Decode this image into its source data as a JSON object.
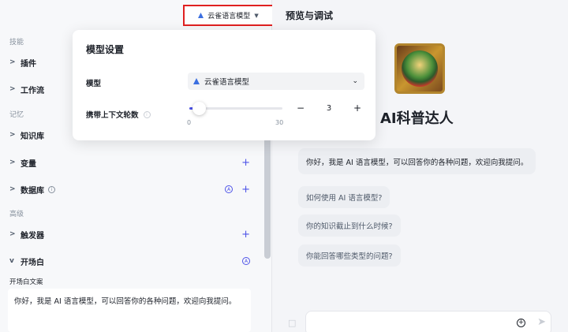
{
  "top_model_chip": {
    "label": "云雀语言模型"
  },
  "sidebar": {
    "sections": {
      "skills": "技能",
      "memory": "记忆",
      "advanced": "高级"
    },
    "items": {
      "plugins": "插件",
      "workflow": "工作流",
      "knowledge": "知识库",
      "variables": "变量",
      "database": "数据库",
      "triggers": "触发器",
      "opening": "开场白"
    },
    "opening_copy_label": "开场白文案",
    "opening_copy_text": "你好，我是 AI 语言模型，可以回答你的各种问题，欢迎向我提问。"
  },
  "model_popover": {
    "title": "模型设置",
    "model_label": "模型",
    "model_value": "云雀语言模型",
    "turns_label": "携带上下文轮数",
    "slider_min": "0",
    "slider_max": "30",
    "turns_value": 3,
    "turns_display": "3",
    "minus": "−",
    "plus": "+"
  },
  "preview": {
    "title": "预览与调试",
    "bot_name": "AI科普达人",
    "greeting": "你好，我是 AI 语言模型，可以回答你的各种问题，欢迎向我提问。",
    "suggestions": [
      "如何使用 AI 语言模型?",
      "你的知识截止到什么时候?",
      "你能回答哪些类型的问题?"
    ]
  },
  "colors": {
    "accent": "#4d53e8",
    "highlight_border": "#e02020"
  }
}
